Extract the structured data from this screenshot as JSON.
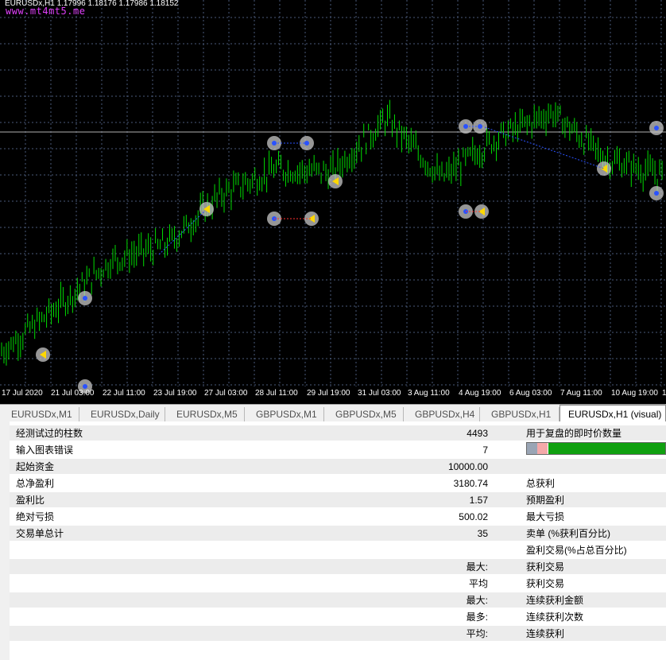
{
  "chart": {
    "header": "EURUSDx,H1  1.17996 1.18176 1.17986 1.18152",
    "watermark": "www.mt4mt5.me",
    "x_labels": [
      "17 Jul 2020",
      "21 Jul 03:00",
      "22 Jul 11:00",
      "23 Jul 19:00",
      "27 Jul 03:00",
      "28 Jul 11:00",
      "29 Jul 19:00",
      "31 Jul 03:00",
      "3 Aug 11:00",
      "4 Aug 19:00",
      "6 Aug 03:00",
      "7 Aug 11:00",
      "10 Aug 19:00",
      "1"
    ],
    "colors": {
      "background": "#000000",
      "grid": "#4a5a7a",
      "candles": "#00dd00",
      "marker": "#c8c8c8",
      "buy": "#2a52ff",
      "sell": "#ffd800"
    },
    "icons": [
      "buy-marker-icon",
      "sell-marker-icon"
    ],
    "chart_data": {
      "type": "line",
      "title": "EURUSDx,H1",
      "open": 1.17996,
      "high": 1.18176,
      "low": 1.17986,
      "close": 1.18152,
      "x": [
        "17 Jul 2020",
        "21 Jul 03:00",
        "22 Jul 11:00",
        "23 Jul 19:00",
        "27 Jul 03:00",
        "28 Jul 11:00",
        "29 Jul 19:00",
        "31 Jul 03:00",
        "3 Aug 11:00",
        "4 Aug 19:00",
        "6 Aug 03:00",
        "7 Aug 11:00",
        "10 Aug 19:00"
      ],
      "series": [
        {
          "values": [
            0.06,
            0.2,
            0.35,
            0.4,
            0.56,
            0.64,
            0.63,
            0.8,
            0.61,
            0.74,
            0.82,
            0.67,
            0.62
          ]
        }
      ],
      "grid": true
    }
  },
  "tabs": [
    {
      "label": "EURUSDx,M1",
      "active": false
    },
    {
      "label": "EURUSDx,Daily",
      "active": false
    },
    {
      "label": "EURUSDx,M5",
      "active": false
    },
    {
      "label": "GBPUSDx,M1",
      "active": false
    },
    {
      "label": "GBPUSDx,M5",
      "active": false
    },
    {
      "label": "GBPUSDx,H4",
      "active": false
    },
    {
      "label": "GBPUSDx,H1",
      "active": false
    },
    {
      "label": "EURUSDx,H1 (visual)",
      "active": true
    }
  ],
  "report": {
    "rows": [
      {
        "label": "经测试过的柱数",
        "value": "4493",
        "label2": "用于复盘的即时价数量"
      },
      {
        "label": "输入图表错误",
        "value": "7",
        "label2": ""
      },
      {
        "label": "起始资金",
        "value": "10000.00",
        "label2": ""
      },
      {
        "label": "总净盈利",
        "value": "3180.74",
        "label2": "总获利"
      },
      {
        "label": "盈利比",
        "value": "1.57",
        "label2": "预期盈利"
      },
      {
        "label": "绝对亏损",
        "value": "500.02",
        "label2": "最大亏损"
      },
      {
        "label": "交易单总计",
        "value": "35",
        "label2": "卖单 (%获利百分比)"
      },
      {
        "label": "",
        "value": "",
        "label2": "盈利交易(%占总百分比)"
      },
      {
        "label": "",
        "value": "最大:",
        "label2": "获利交易"
      },
      {
        "label": "",
        "value": "平均",
        "label2": "获利交易"
      },
      {
        "label": "",
        "value": "最大:",
        "label2": "连续获利金额"
      },
      {
        "label": "",
        "value": "最多:",
        "label2": "连续获利次数"
      },
      {
        "label": "",
        "value": "平均:",
        "label2": "连续获利"
      }
    ],
    "progress": {
      "segments": [
        0.07,
        0.07,
        0.86
      ],
      "colors": [
        "#9aa5b5",
        "#f4a9a9",
        "#10a010"
      ]
    }
  }
}
